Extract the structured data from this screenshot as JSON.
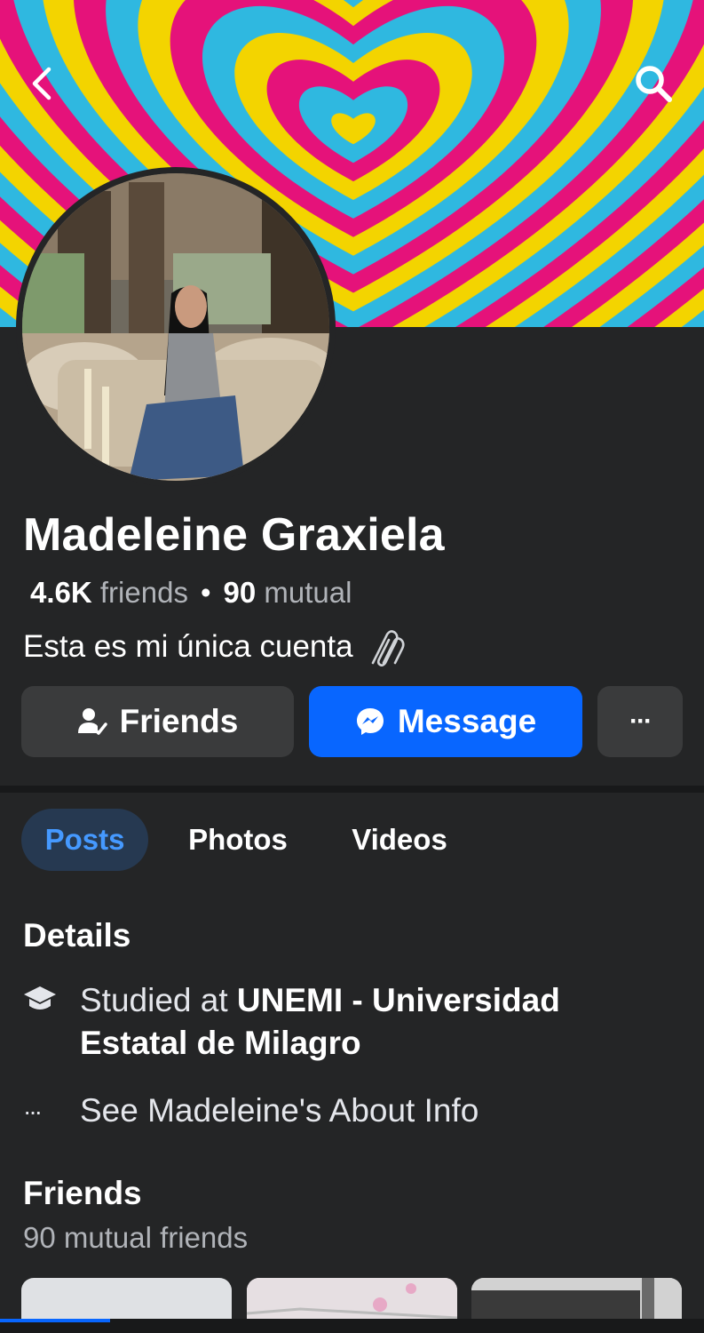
{
  "header": {
    "back_icon": "chevron-left-icon",
    "search_icon": "search-icon"
  },
  "profile": {
    "name": "Madeleine Graxiela",
    "friends_count": "4.6K",
    "friends_label": "friends",
    "separator": "•",
    "mutual_count": "90",
    "mutual_label": "mutual",
    "bio": "Esta es mi única cuenta"
  },
  "actions": {
    "friends_label": "Friends",
    "message_label": "Message",
    "more_label": "···"
  },
  "tabs": [
    {
      "label": "Posts",
      "active": true
    },
    {
      "label": "Photos",
      "active": false
    },
    {
      "label": "Videos",
      "active": false
    }
  ],
  "details": {
    "heading": "Details",
    "education_prefix": "Studied at",
    "education_school_line1": "UNEMI - Universidad",
    "education_school_line2": "Estatal de Milagro",
    "about_link": "See Madeleine's About Info",
    "more_icon": "···"
  },
  "friends_section": {
    "heading": "Friends",
    "subtitle": "90 mutual friends"
  },
  "colors": {
    "background": "#242526",
    "accent": "#0866ff",
    "tab_active_bg": "#263951",
    "tab_active_text": "#4599ff",
    "cover_pink": "#e5127a",
    "cover_blue": "#2fb8e0",
    "cover_yellow": "#f3d400"
  }
}
